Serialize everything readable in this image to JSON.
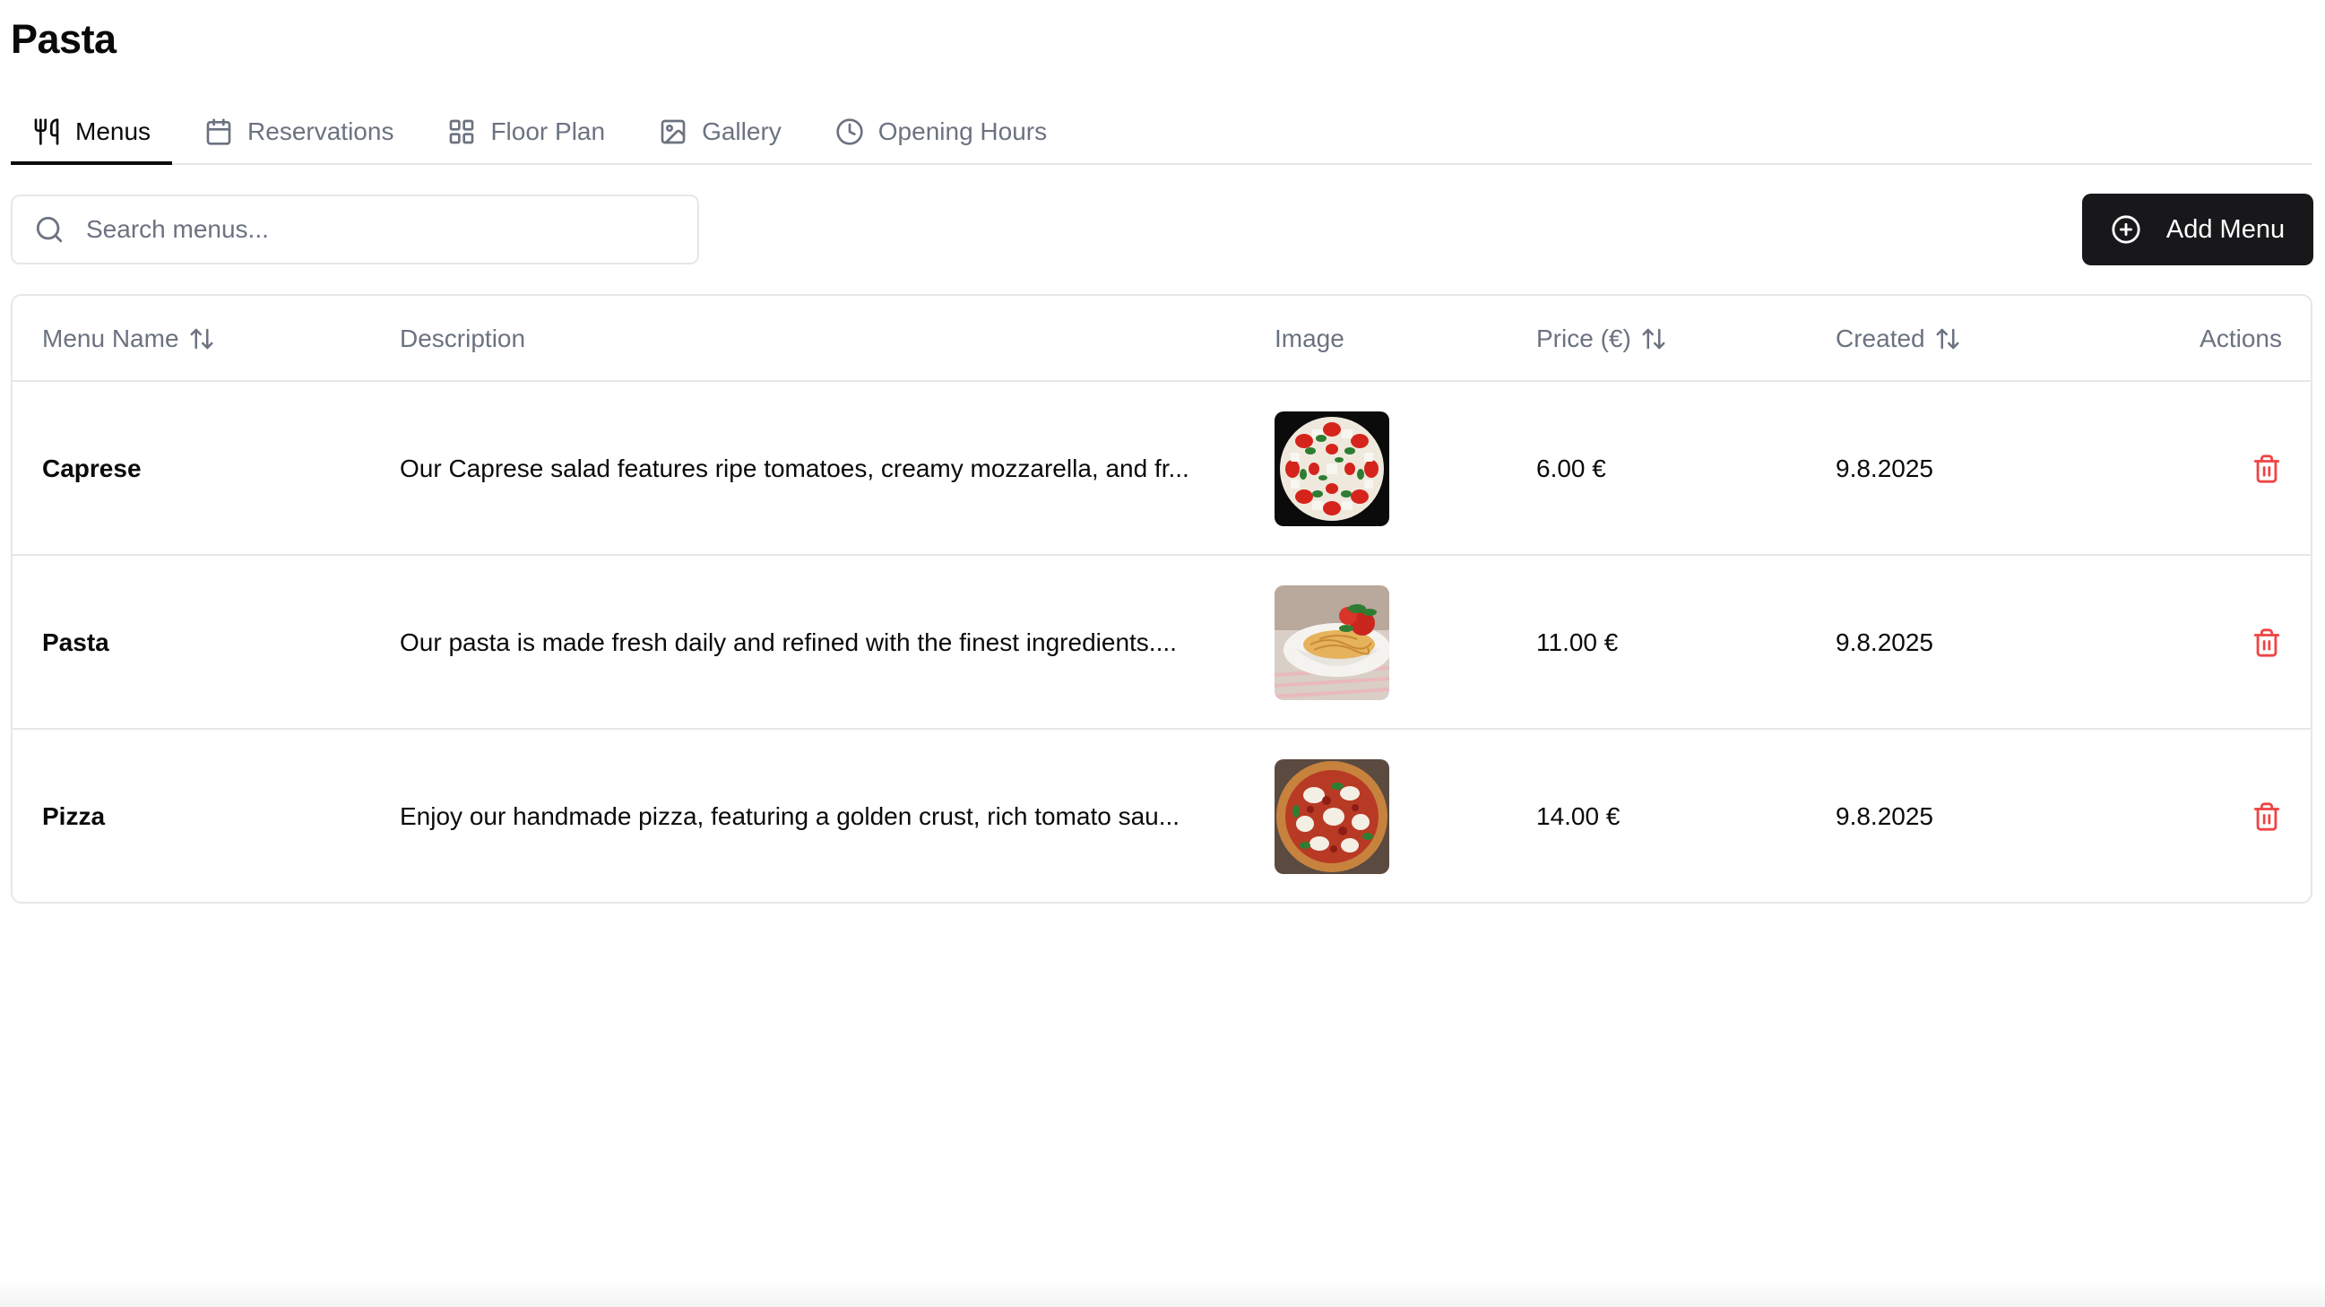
{
  "page": {
    "title": "Pasta"
  },
  "tabs": [
    {
      "label": "Menus",
      "icon": "utensils-icon",
      "active": true
    },
    {
      "label": "Reservations",
      "icon": "calendar-icon",
      "active": false
    },
    {
      "label": "Floor Plan",
      "icon": "grid-icon",
      "active": false
    },
    {
      "label": "Gallery",
      "icon": "image-icon",
      "active": false
    },
    {
      "label": "Opening Hours",
      "icon": "clock-icon",
      "active": false
    }
  ],
  "search": {
    "placeholder": "Search menus...",
    "value": ""
  },
  "toolbar": {
    "add_label": "Add Menu"
  },
  "table": {
    "columns": {
      "name": "Menu Name",
      "description": "Description",
      "image": "Image",
      "price": "Price (€)",
      "created": "Created",
      "actions": "Actions"
    },
    "rows": [
      {
        "name": "Caprese",
        "description": "Our Caprese salad features ripe tomatoes, creamy mozzarella, and fr...",
        "price": "6.00 €",
        "created": "9.8.2025"
      },
      {
        "name": "Pasta",
        "description": "Our pasta is made fresh daily and refined with the finest ingredients....",
        "price": "11.00 €",
        "created": "9.8.2025"
      },
      {
        "name": "Pizza",
        "description": "Enjoy our handmade pizza, featuring a golden crust, rich tomato sau...",
        "price": "14.00 €",
        "created": "9.8.2025"
      }
    ]
  },
  "colors": {
    "primary": "#18181b",
    "muted": "#6b7280",
    "border": "#e5e7eb",
    "danger": "#ef4444"
  }
}
